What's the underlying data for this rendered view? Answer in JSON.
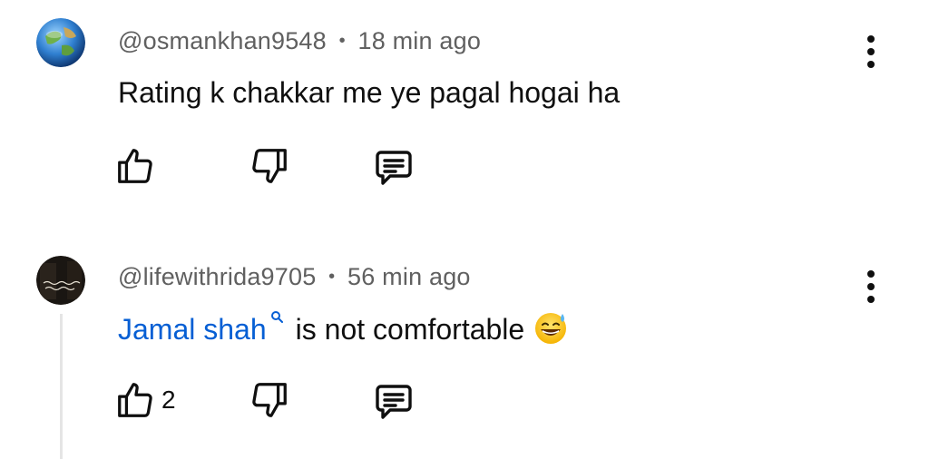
{
  "comments": [
    {
      "author": "@osmankhan9548",
      "separator": "•",
      "time": "18 min ago",
      "text": "Rating k chakkar me ye pagal hogai ha",
      "likes": "",
      "avatar": "globe-avatar"
    },
    {
      "author": "@lifewithrida9705",
      "separator": "•",
      "time": "56 min ago",
      "mention": "Jamal shah",
      "text": "is not comfortable",
      "emoji": "grinning-sweat-emoji",
      "likes": "2",
      "avatar": "dark-text-avatar"
    }
  ],
  "icons": {
    "like": "thumbs-up-icon",
    "dislike": "thumbs-down-icon",
    "reply": "reply-comment-icon",
    "more": "more-vert-icon",
    "mention": "search-magnifier-icon"
  },
  "colors": {
    "text": "#0f0f0f",
    "secondary": "#606060",
    "link": "#065fd4"
  }
}
